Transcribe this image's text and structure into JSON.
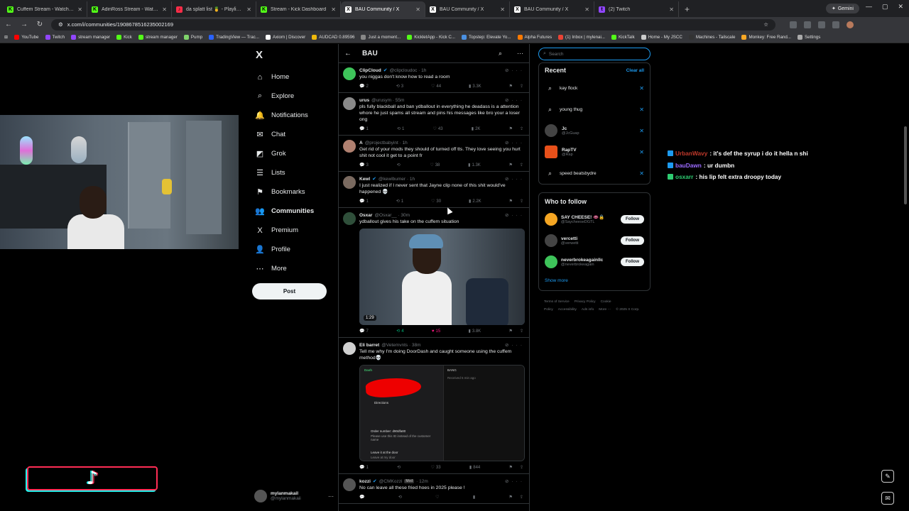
{
  "browser": {
    "tabs": [
      {
        "title": "Cuffem Stream - Watch Live on",
        "color": "#53fc18",
        "glyph": "K",
        "active": false
      },
      {
        "title": "AdinRoss Stream - Watch Live o",
        "color": "#53fc18",
        "glyph": "K",
        "active": false
      },
      {
        "title": "da splatt list 🍍 - Playlist - Ap",
        "color": "#fa2d48",
        "glyph": "♪",
        "active": false
      },
      {
        "title": "Stream - Kick Dashboard",
        "color": "#53fc18",
        "glyph": "K",
        "active": false
      },
      {
        "title": "BAU Community / X",
        "color": "#ffffff",
        "glyph": "X",
        "active": true
      },
      {
        "title": "BAU Community / X",
        "color": "#ffffff",
        "glyph": "X",
        "active": false
      },
      {
        "title": "BAU Community / X",
        "color": "#ffffff",
        "glyph": "X",
        "active": false
      },
      {
        "title": "(2) Twitch",
        "color": "#9146ff",
        "glyph": "t",
        "active": false
      }
    ],
    "new_tab": "+",
    "gemini_label": "Gemini",
    "url": "x.com/i/communities/1908678516235002169",
    "bookmarks": [
      {
        "label": "YouTube",
        "color": "#ff0000"
      },
      {
        "label": "Twitch",
        "color": "#9146ff"
      },
      {
        "label": "stream manager",
        "color": "#9146ff"
      },
      {
        "label": "Kick",
        "color": "#53fc18"
      },
      {
        "label": "stream manager",
        "color": "#53fc18"
      },
      {
        "label": "Pump",
        "color": "#7fd36b"
      },
      {
        "label": "TradingView — Trac...",
        "color": "#2962ff"
      },
      {
        "label": "Axiom | Discover",
        "color": "#ffffff"
      },
      {
        "label": "AUDCAD 0.89596",
        "color": "#f0b90b"
      },
      {
        "label": "Just a moment...",
        "color": "#888888"
      },
      {
        "label": "KickletApp - Kick C...",
        "color": "#53fc18"
      },
      {
        "label": "Topstep: Elevate Yo...",
        "color": "#4a90e2"
      },
      {
        "label": "Alpha Futures",
        "color": "#ff7a00"
      },
      {
        "label": "(1) Inbox | mylenai...",
        "color": "#ea4335"
      },
      {
        "label": "KickTalk",
        "color": "#53fc18"
      },
      {
        "label": "Home - My JSCC",
        "color": "#cccccc"
      },
      {
        "label": "Machines - Tailscale",
        "color": "#333333"
      },
      {
        "label": "Monkey: Free Rand...",
        "color": "#f9a825"
      },
      {
        "label": "Settings",
        "color": "#aaaaaa"
      }
    ]
  },
  "overlay": {
    "chat": [
      {
        "user": "UrbanWavy",
        "user_color": "#c0392b",
        "badge": "#1d9bf0",
        "text": ": it's def the syrup i do it hella n shi"
      },
      {
        "user": "bauDawn",
        "user_color": "#9b6bff",
        "badge": "#1d9bf0",
        "text": ": ur dumbn"
      },
      {
        "user": "osxarr",
        "user_color": "#2ecc71",
        "badge": "#2ecc71",
        "text": ": his lip felt extra droopy today"
      }
    ]
  },
  "xnav": {
    "logo": "X",
    "items": [
      {
        "label": "Home",
        "icon": "⌂",
        "name": "home"
      },
      {
        "label": "Explore",
        "icon": "⌕",
        "name": "explore"
      },
      {
        "label": "Notifications",
        "icon": "🔔",
        "name": "notifications"
      },
      {
        "label": "Chat",
        "icon": "✉",
        "name": "chat"
      },
      {
        "label": "Grok",
        "icon": "◩",
        "name": "grok"
      },
      {
        "label": "Lists",
        "icon": "☰",
        "name": "lists"
      },
      {
        "label": "Bookmarks",
        "icon": "⚑",
        "name": "bookmarks"
      },
      {
        "label": "Communities",
        "icon": "👥",
        "name": "communities"
      },
      {
        "label": "Premium",
        "icon": "X",
        "name": "premium"
      },
      {
        "label": "Profile",
        "icon": "👤",
        "name": "profile"
      },
      {
        "label": "More",
        "icon": "⋯",
        "name": "more"
      }
    ],
    "active": "Communities",
    "post_label": "Post",
    "account": {
      "name": "mylanmakail",
      "handle": "@mylanmakaii",
      "more": "···"
    }
  },
  "feed": {
    "title": "BAU",
    "tweets": [
      {
        "name": "ClipCloud",
        "verified": true,
        "handle": "@clipcloudoc · 1h",
        "text": "you niggas don't know how to read a room",
        "avatar_color": "#3ec45a",
        "replies": "2",
        "reposts": "3",
        "likes": "44",
        "views": "3.3K",
        "rt_on": false,
        "like_on": false
      },
      {
        "name": "urus",
        "verified": false,
        "handle": "@urusym · 55m",
        "text": "pls fully blackball and ban ydballout in everything he deadass is a attention whore he just spams all stream and pins his messages like bro your a loser ong",
        "avatar_color": "#8a8a8a",
        "replies": "1",
        "reposts": "1",
        "likes": "43",
        "views": "2K",
        "rt_on": false,
        "like_on": false
      },
      {
        "name": "A",
        "verified": false,
        "handle": "@projectbabyint · 1h",
        "text": "Get rid of your mods they should of turned off tts. They love seeing you hurt shit not cool it get to a point fr",
        "avatar_color": "#b08070",
        "replies": "3",
        "reposts": "",
        "likes": "38",
        "views": "1.3K",
        "rt_on": false,
        "like_on": false
      },
      {
        "name": "Kewl",
        "verified": true,
        "handle": "@kewlbumer · 1h",
        "text": "I just realized if I never sent that Jayne clip none of this shit would've happened 💀",
        "avatar_color": "#7a6a60",
        "replies": "1",
        "reposts": "1",
        "likes": "30",
        "views": "2.2K",
        "rt_on": false,
        "like_on": false
      },
      {
        "name": "Osxar",
        "verified": false,
        "handle": "@Osxar__ · 30m",
        "text": "ydballout gives his take on the cuffem situation",
        "avatar_color": "#2f4f3a",
        "replies": "7",
        "reposts": "4",
        "likes": "15",
        "views": "3.8K",
        "rt_on": true,
        "like_on": true,
        "video_duration": "1:29"
      },
      {
        "name": "Eli barret",
        "verified": false,
        "handle": "@Vetemvnts · 38m",
        "text": "Tell me why I'm doing DoorDash and caught someone using the cuffem method💀",
        "avatar_color": "#d0d0d0",
        "replies": "1",
        "reposts": "",
        "likes": "33",
        "views": "844",
        "rt_on": false,
        "like_on": false
      },
      {
        "name": "kozzi",
        "verified": true,
        "handle": "@CMKozzi",
        "mod_badge": "Mod",
        "handle_time": "· 12m",
        "text": "No can leave all these fried hoes in 2025 please !",
        "avatar_color": "#555555",
        "replies": "",
        "reposts": "",
        "likes": "",
        "views": "",
        "rt_on": false,
        "like_on": false
      }
    ],
    "doordash": {
      "app": "Dash",
      "directions": "Directions",
      "order_number": "Order number: d90dfa80",
      "order_note": "Please use this ID instead of the customer name",
      "leave": "Leave it at the door",
      "leave_sub": "Leave at my door",
      "right_title": "BANG",
      "right_sub": "Received 5 min ago"
    }
  },
  "sidebar": {
    "search_placeholder": "Search",
    "recent_title": "Recent",
    "clear_all": "Clear all",
    "recent": [
      {
        "type": "query",
        "label": "kay flock"
      },
      {
        "type": "query",
        "label": "young thug"
      },
      {
        "type": "user",
        "label": "Jc",
        "handle": "@JcGuap"
      },
      {
        "type": "user",
        "label": "RapTV",
        "handle": "@Rap",
        "verified": true
      },
      {
        "type": "query",
        "label": "speed beatsbydre"
      }
    ],
    "wtf_title": "Who to follow",
    "wtf": [
      {
        "name": "SAY CHEESE! 👄🔒",
        "handle": "@SaycheeseDGTL",
        "avatar_color": "#f5a623",
        "button": "Follow"
      },
      {
        "name": "vercetti",
        "handle": "@verwetti",
        "avatar_color": "#444444",
        "button": "Follow"
      },
      {
        "name": "neverbrokeagainllc",
        "handle": "@neverbrokeagain",
        "avatar_color": "#3ec45a",
        "button": "Follow"
      }
    ],
    "show_more": "Show more",
    "footer": [
      "Terms of Service",
      "Privacy Policy",
      "Cookie Policy",
      "Accessibility",
      "Ads info",
      "More ···",
      "© 2025 X Corp."
    ]
  }
}
